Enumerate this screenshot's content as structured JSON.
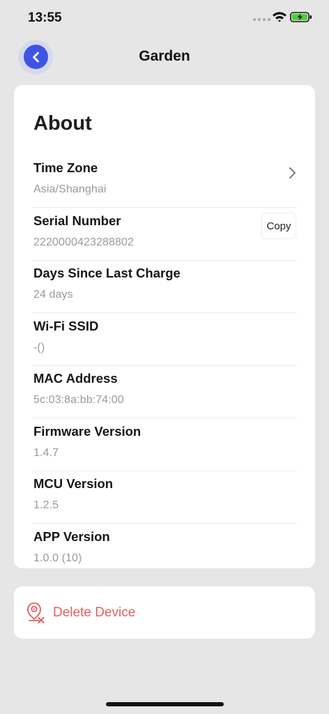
{
  "status_bar": {
    "time": "13:55"
  },
  "header": {
    "title": "Garden"
  },
  "about": {
    "title": "About",
    "rows": [
      {
        "label": "Time Zone",
        "value": "Asia/Shanghai"
      },
      {
        "label": "Serial Number",
        "value": "2220000423288802"
      },
      {
        "label": "Days Since Last Charge",
        "value": "24 days"
      },
      {
        "label": "Wi-Fi SSID",
        "value": "-()"
      },
      {
        "label": "MAC Address",
        "value": "5c:03:8a:bb:74:00"
      },
      {
        "label": "Firmware Version",
        "value": "1.4.7"
      },
      {
        "label": "MCU Version",
        "value": "1.2.5"
      },
      {
        "label": "APP Version",
        "value": "1.0.0 (10)"
      }
    ],
    "copy_label": "Copy"
  },
  "delete": {
    "label": "Delete Device"
  },
  "colors": {
    "accent": "#3d54e6",
    "danger": "#e06060",
    "background": "#e6e6e6",
    "battery": "#4cd137"
  },
  "icons": {
    "back": "chevron-left-icon",
    "time_zone": "chevron-right-icon",
    "delete": "device-delete-icon"
  }
}
